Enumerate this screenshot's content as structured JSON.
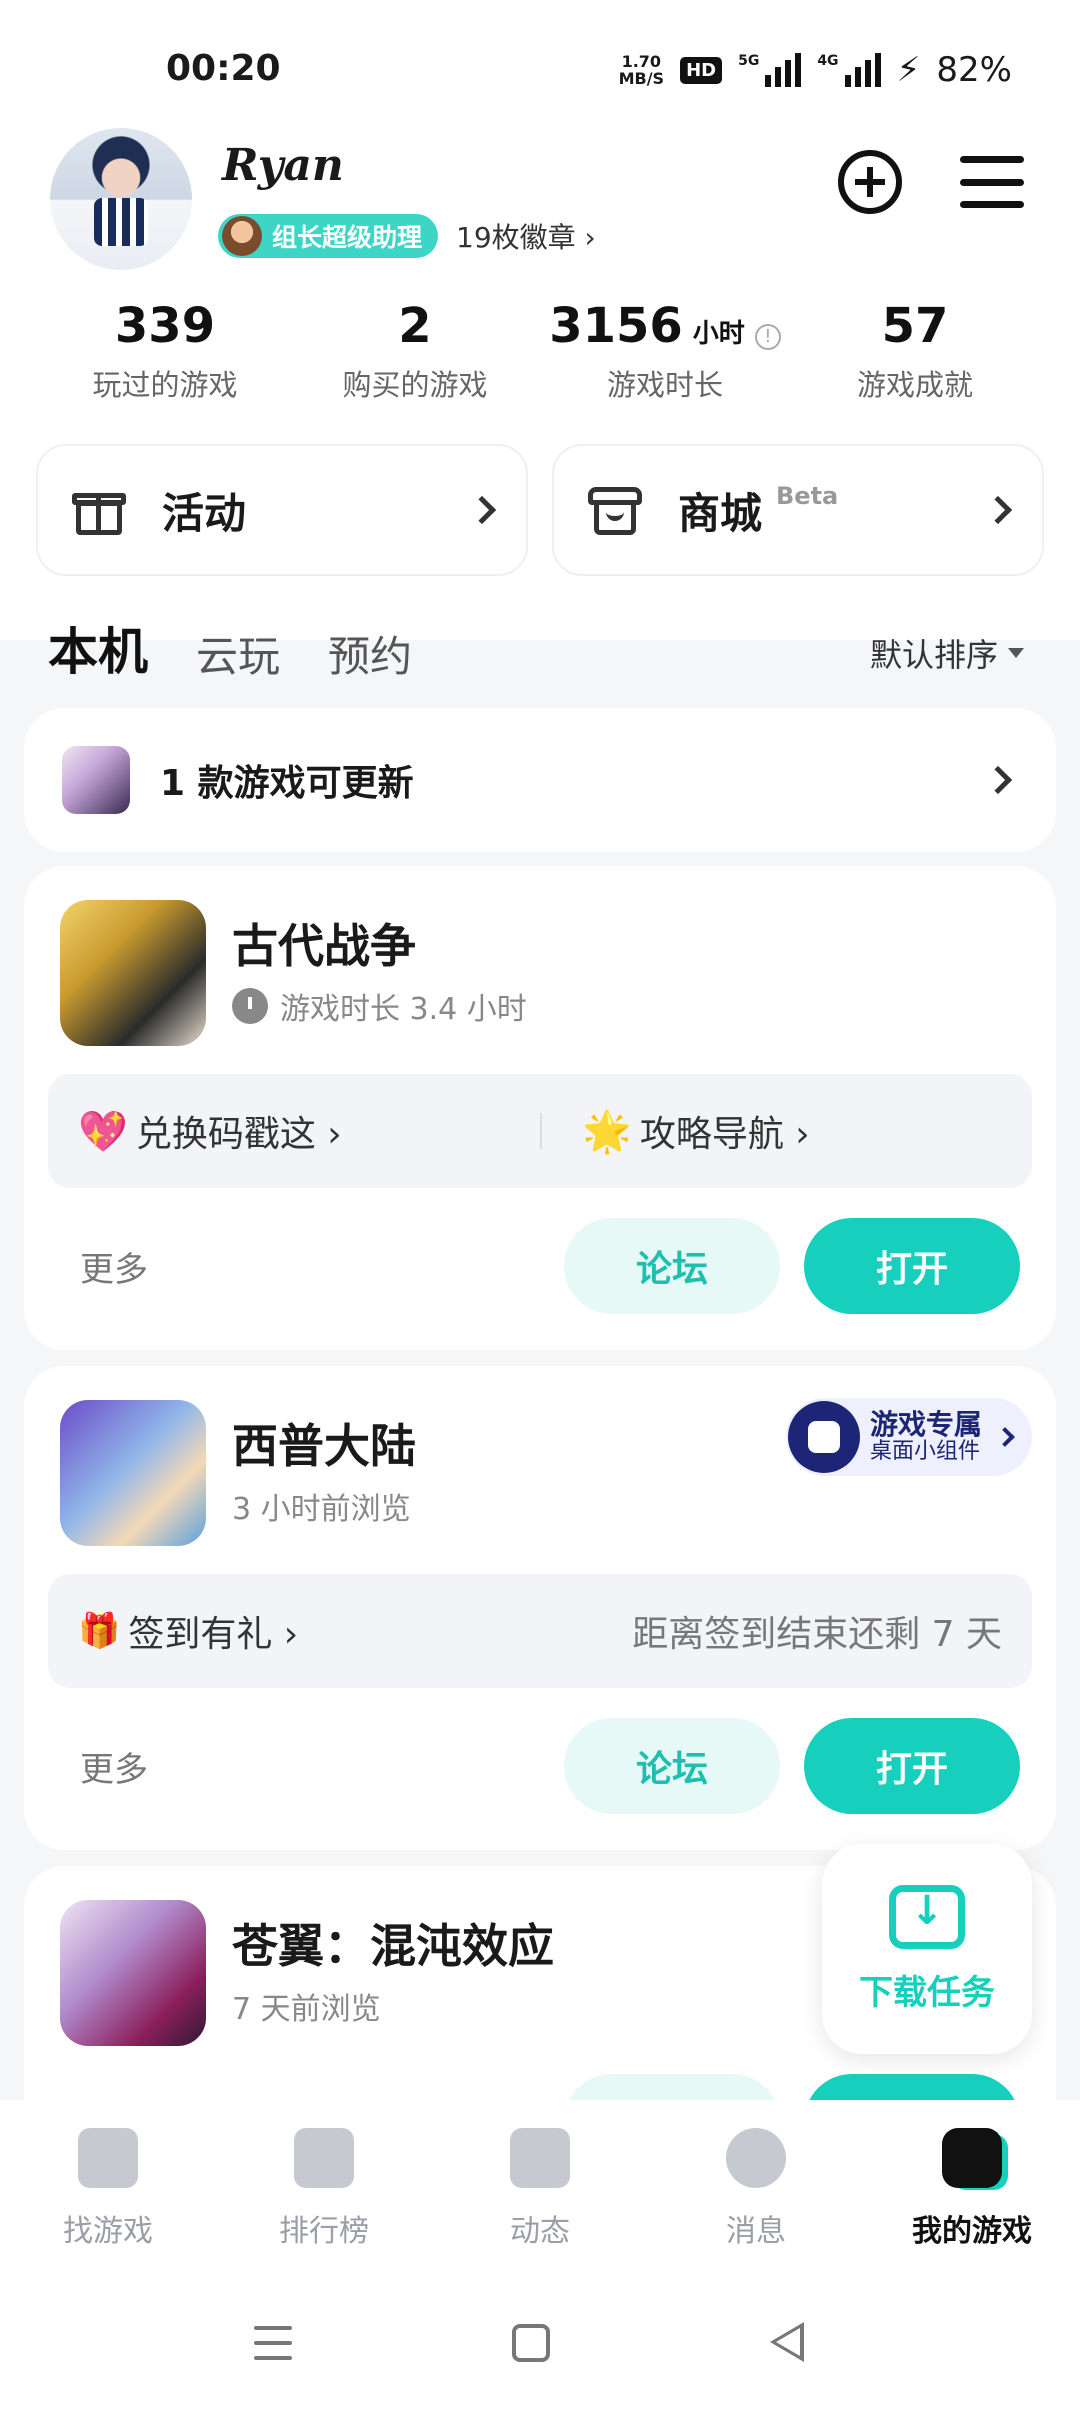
{
  "status_bar": {
    "time": "00:20",
    "speed_value": "1.70",
    "speed_unit": "MB/S",
    "hd": "HD",
    "net1": "5G",
    "net2": "4G",
    "battery": "82%"
  },
  "profile": {
    "username": "Ryan",
    "role_badge": "组长超级助理",
    "medals": "19枚徽章 ›"
  },
  "stats": [
    {
      "value": "339",
      "unit": "",
      "label": "玩过的游戏"
    },
    {
      "value": "2",
      "unit": "",
      "label": "购买的游戏"
    },
    {
      "value": "3156",
      "unit": "小时",
      "label": "游戏时长"
    },
    {
      "value": "57",
      "unit": "",
      "label": "游戏成就"
    }
  ],
  "quick": {
    "activity_label": "活动",
    "shop_label": "商城",
    "shop_beta": "Beta"
  },
  "tabs": {
    "local": "本机",
    "cloud": "云玩",
    "reserve": "预约",
    "sort": "默认排序"
  },
  "update_bar": {
    "label": "1 款游戏可更新"
  },
  "games": [
    {
      "name": "古代战争",
      "sub": "游戏时长 3.4 小时",
      "panel_left": "兑换码戳这 ›",
      "panel_right": "攻略导航 ›",
      "more": "更多",
      "forum": "论坛",
      "open": "打开"
    },
    {
      "name": "西普大陆",
      "sub": "3 小时前浏览",
      "widget_title": "游戏专属",
      "widget_sub": "桌面小组件",
      "panel_left": "签到有礼 ›",
      "panel_right": "距离签到结束还剩 7 天",
      "more": "更多",
      "forum": "论坛",
      "open": "打开"
    },
    {
      "name": "苍翼：混沌效应",
      "sub": "7 天前浏览"
    }
  ],
  "download_fab": {
    "label": "下载任务"
  },
  "bottom_nav": [
    {
      "label": "找游戏"
    },
    {
      "label": "排行榜"
    },
    {
      "label": "动态"
    },
    {
      "label": "消息"
    },
    {
      "label": "我的游戏"
    }
  ],
  "colors": {
    "accent": "#16d0bd",
    "widget_navy": "#1c2576"
  }
}
